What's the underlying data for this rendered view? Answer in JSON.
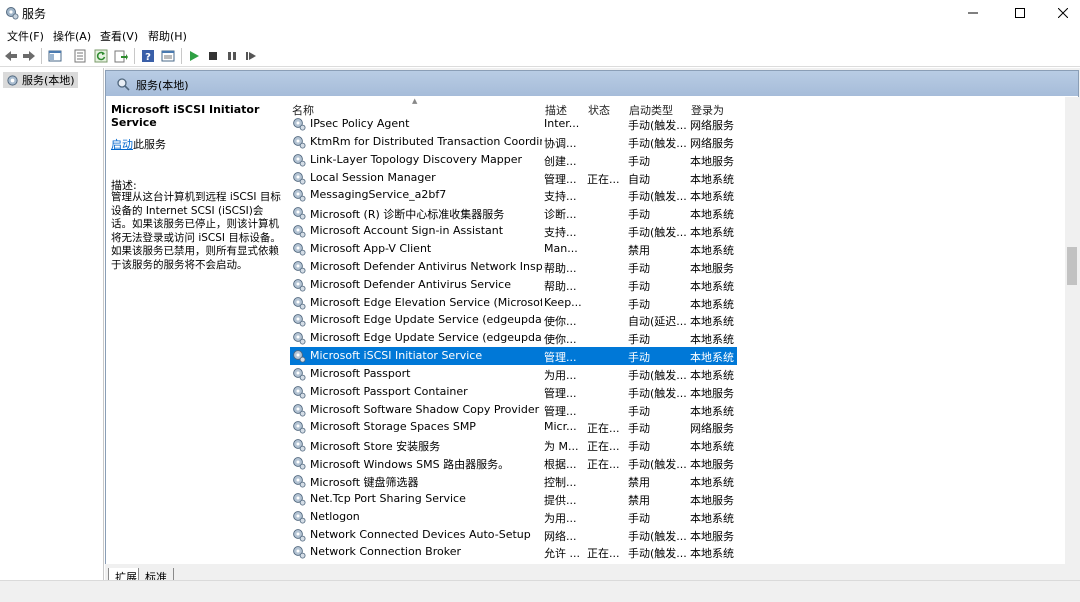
{
  "window": {
    "title": "服务"
  },
  "menu": [
    "文件(F)",
    "操作(A)",
    "查看(V)",
    "帮助(H)"
  ],
  "tree": {
    "root": "服务(本地)"
  },
  "panel": {
    "header": "服务(本地)"
  },
  "detail": {
    "service_name": "Microsoft iSCSI Initiator Service",
    "start_link": "启动",
    "start_suffix": "此服务",
    "desc_label": "描述:",
    "desc_text": "管理从这台计算机到远程 iSCSI 目标设备的 Internet SCSI (iSCSI)会话。如果该服务已停止，则该计算机将无法登录或访问 iSCSI 目标设备。如果该服务已禁用，则所有显式依赖于该服务的服务将不会启动。"
  },
  "columns": {
    "name": "名称",
    "desc": "描述",
    "status": "状态",
    "start": "启动类型",
    "logon": "登录为"
  },
  "rows": [
    {
      "name": "IPsec Policy Agent",
      "desc": "Inter...",
      "status": "",
      "start": "手动(触发...",
      "logon": "网络服务"
    },
    {
      "name": "KtmRm for Distributed Transaction Coordinator",
      "desc": "协调...",
      "status": "",
      "start": "手动(触发...",
      "logon": "网络服务"
    },
    {
      "name": "Link-Layer Topology Discovery Mapper",
      "desc": "创建...",
      "status": "",
      "start": "手动",
      "logon": "本地服务"
    },
    {
      "name": "Local Session Manager",
      "desc": "管理...",
      "status": "正在...",
      "start": "自动",
      "logon": "本地系统"
    },
    {
      "name": "MessagingService_a2bf7",
      "desc": "支持...",
      "status": "",
      "start": "手动(触发...",
      "logon": "本地系统"
    },
    {
      "name": "Microsoft (R) 诊断中心标准收集器服务",
      "desc": "诊断...",
      "status": "",
      "start": "手动",
      "logon": "本地系统"
    },
    {
      "name": "Microsoft Account Sign-in Assistant",
      "desc": "支持...",
      "status": "",
      "start": "手动(触发...",
      "logon": "本地系统"
    },
    {
      "name": "Microsoft App-V Client",
      "desc": "Man...",
      "status": "",
      "start": "禁用",
      "logon": "本地系统"
    },
    {
      "name": "Microsoft Defender Antivirus Network Inspection...",
      "desc": "帮助...",
      "status": "",
      "start": "手动",
      "logon": "本地服务"
    },
    {
      "name": "Microsoft Defender Antivirus Service",
      "desc": "帮助...",
      "status": "",
      "start": "手动",
      "logon": "本地系统"
    },
    {
      "name": "Microsoft Edge Elevation Service (MicrosoftEdge...",
      "desc": "Keep...",
      "status": "",
      "start": "手动",
      "logon": "本地系统"
    },
    {
      "name": "Microsoft Edge Update Service (edgeupdate)",
      "desc": "使你...",
      "status": "",
      "start": "自动(延迟...",
      "logon": "本地系统"
    },
    {
      "name": "Microsoft Edge Update Service (edgeupdatem)",
      "desc": "使你...",
      "status": "",
      "start": "手动",
      "logon": "本地系统"
    },
    {
      "name": "Microsoft iSCSI Initiator Service",
      "desc": "管理...",
      "status": "",
      "start": "手动",
      "logon": "本地系统",
      "selected": true
    },
    {
      "name": "Microsoft Passport",
      "desc": "为用...",
      "status": "",
      "start": "手动(触发...",
      "logon": "本地系统"
    },
    {
      "name": "Microsoft Passport Container",
      "desc": "管理...",
      "status": "",
      "start": "手动(触发...",
      "logon": "本地服务"
    },
    {
      "name": "Microsoft Software Shadow Copy Provider",
      "desc": "管理...",
      "status": "",
      "start": "手动",
      "logon": "本地系统"
    },
    {
      "name": "Microsoft Storage Spaces SMP",
      "desc": "Micr...",
      "status": "正在...",
      "start": "手动",
      "logon": "网络服务"
    },
    {
      "name": "Microsoft Store 安装服务",
      "desc": "为 M...",
      "status": "正在...",
      "start": "手动",
      "logon": "本地系统"
    },
    {
      "name": "Microsoft Windows SMS 路由器服务。",
      "desc": "根据...",
      "status": "正在...",
      "start": "手动(触发...",
      "logon": "本地服务"
    },
    {
      "name": "Microsoft 键盘筛选器",
      "desc": "控制...",
      "status": "",
      "start": "禁用",
      "logon": "本地系统"
    },
    {
      "name": "Net.Tcp Port Sharing Service",
      "desc": "提供...",
      "status": "",
      "start": "禁用",
      "logon": "本地服务"
    },
    {
      "name": "Netlogon",
      "desc": "为用...",
      "status": "",
      "start": "手动",
      "logon": "本地系统"
    },
    {
      "name": "Network Connected Devices Auto-Setup",
      "desc": "网络...",
      "status": "",
      "start": "手动(触发...",
      "logon": "本地服务"
    },
    {
      "name": "Network Connection Broker",
      "desc": "允许 ...",
      "status": "正在...",
      "start": "手动(触发...",
      "logon": "本地系统"
    }
  ],
  "tabs": [
    "扩展",
    "标准"
  ],
  "colors": {
    "selection": "#0078d7",
    "header": "#b8cce4",
    "link": "#0066cc"
  },
  "icons": [
    "services-app-icon",
    "back-icon",
    "forward-icon",
    "console-tree-icon",
    "properties-icon",
    "refresh-icon",
    "export-icon",
    "help-icon",
    "view-icon",
    "start-icon",
    "stop-icon",
    "pause-icon",
    "restart-icon",
    "gear-icon"
  ]
}
